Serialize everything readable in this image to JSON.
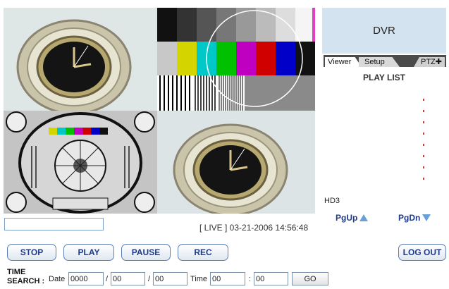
{
  "panel": {
    "title": "DVR"
  },
  "tabs": {
    "viewer": "Viewer",
    "setup": "Setup",
    "ptz": "PTZ✚"
  },
  "playlist": {
    "title": "PLAY LIST"
  },
  "drive_label": "HD3",
  "paging": {
    "up": "PgUp",
    "down": "PgDn"
  },
  "status": {
    "input_value": "",
    "live_text": "[ LIVE ] 03-21-2006 14:56:48"
  },
  "controls": {
    "stop": "STOP",
    "play": "PLAY",
    "pause": "PAUSE",
    "rec": "REC",
    "logout": "LOG OUT"
  },
  "time_search": {
    "label_line1": "TIME",
    "label_line2": "SEARCH :",
    "date_label": "Date",
    "year": "0000",
    "sep1": "/",
    "month": "00",
    "sep2": "/",
    "day": "00",
    "time_label": "Time",
    "hour": "00",
    "colon": ":",
    "minute": "00",
    "go": "GO"
  },
  "colors": {
    "accent_blue": "#1e3a8a",
    "panel_bg": "#d3e3ef",
    "tab_bar": "#4a4a4a",
    "arrow": "#6aa0d8"
  }
}
